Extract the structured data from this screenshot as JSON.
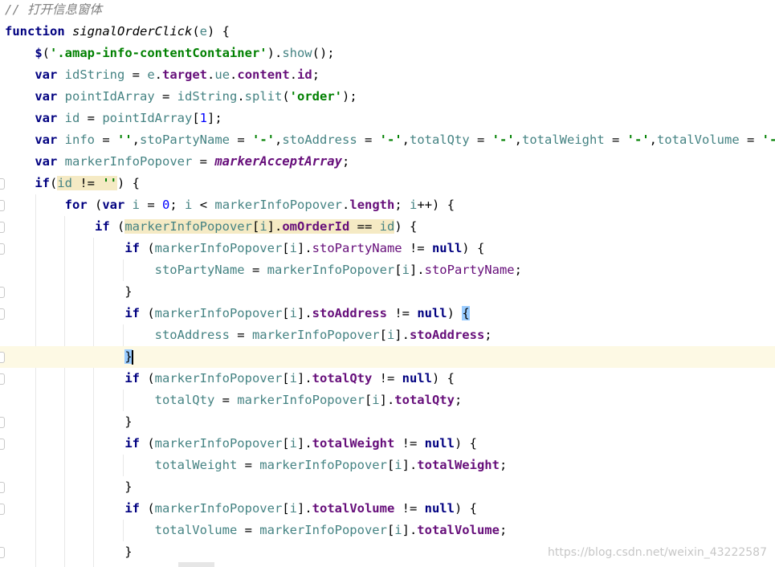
{
  "editor": {
    "comment": "// 打开信息窗体",
    "watermark": "https://blog.csdn.net/weixin_43222587"
  },
  "colors": {
    "keyword": "#000080",
    "string": "#008000",
    "local_variable": "#458383",
    "property": "#660e7a",
    "number": "#0000ff",
    "comment": "#808080",
    "caret_line": "#fdf9e4",
    "usage_highlight": "#f5eac4",
    "brace_match": "#99ccff"
  },
  "lines": [
    {
      "name": "line-1",
      "tokens": [
        [
          "cmt",
          "// 打开信息窗体"
        ]
      ]
    },
    {
      "name": "line-2",
      "tokens": [
        [
          "kw",
          "function"
        ],
        [
          "plain",
          " "
        ],
        [
          "fn",
          "signalOrderClick"
        ],
        [
          "plain",
          "("
        ],
        [
          "var",
          "e"
        ],
        [
          "plain",
          ") {"
        ]
      ]
    },
    {
      "name": "line-3",
      "tokens": [
        [
          "plain",
          "    "
        ],
        [
          "kw",
          "$"
        ],
        [
          "plain",
          "("
        ],
        [
          "str",
          "'.amap-info-contentContainer'"
        ],
        [
          "plain",
          ")."
        ],
        [
          "var",
          "show"
        ],
        [
          "plain",
          "();"
        ]
      ]
    },
    {
      "name": "line-4",
      "tokens": [
        [
          "plain",
          "    "
        ],
        [
          "kw",
          "var"
        ],
        [
          "plain",
          " "
        ],
        [
          "var",
          "idString"
        ],
        [
          "plain",
          " = "
        ],
        [
          "var",
          "e"
        ],
        [
          "plain",
          "."
        ],
        [
          "prop",
          "target"
        ],
        [
          "plain",
          "."
        ],
        [
          "var",
          "ue"
        ],
        [
          "plain",
          "."
        ],
        [
          "prop",
          "content"
        ],
        [
          "plain",
          "."
        ],
        [
          "prop",
          "id"
        ],
        [
          "plain",
          ";"
        ]
      ]
    },
    {
      "name": "line-5",
      "tokens": [
        [
          "plain",
          "    "
        ],
        [
          "kw",
          "var"
        ],
        [
          "plain",
          " "
        ],
        [
          "var",
          "pointIdArray"
        ],
        [
          "plain",
          " = "
        ],
        [
          "var",
          "idString"
        ],
        [
          "plain",
          "."
        ],
        [
          "var",
          "split"
        ],
        [
          "plain",
          "("
        ],
        [
          "str",
          "'order'"
        ],
        [
          "plain",
          ");"
        ]
      ]
    },
    {
      "name": "line-6",
      "tokens": [
        [
          "plain",
          "    "
        ],
        [
          "kw",
          "var"
        ],
        [
          "plain",
          " "
        ],
        [
          "var",
          "id"
        ],
        [
          "plain",
          " = "
        ],
        [
          "var",
          "pointIdArray"
        ],
        [
          "plain",
          "["
        ],
        [
          "num",
          "1"
        ],
        [
          "plain",
          "];"
        ]
      ]
    },
    {
      "name": "line-7",
      "tokens": [
        [
          "plain",
          "    "
        ],
        [
          "kw",
          "var"
        ],
        [
          "plain",
          " "
        ],
        [
          "var",
          "info"
        ],
        [
          "plain",
          " = "
        ],
        [
          "str",
          "''"
        ],
        [
          "plain",
          ","
        ],
        [
          "var",
          "stoPartyName"
        ],
        [
          "plain",
          " = "
        ],
        [
          "str",
          "'-'"
        ],
        [
          "plain",
          ","
        ],
        [
          "var",
          "stoAddress"
        ],
        [
          "plain",
          " = "
        ],
        [
          "str",
          "'-'"
        ],
        [
          "plain",
          ","
        ],
        [
          "var",
          "totalQty"
        ],
        [
          "plain",
          " = "
        ],
        [
          "str",
          "'-'"
        ],
        [
          "plain",
          ","
        ],
        [
          "var",
          "totalWeight"
        ],
        [
          "plain",
          " = "
        ],
        [
          "str",
          "'-'"
        ],
        [
          "plain",
          ","
        ],
        [
          "var",
          "totalVolume"
        ],
        [
          "plain",
          " = "
        ],
        [
          "str",
          "'-'"
        ],
        [
          "plain",
          ";"
        ]
      ]
    },
    {
      "name": "line-8",
      "tokens": [
        [
          "plain",
          "    "
        ],
        [
          "kw",
          "var"
        ],
        [
          "plain",
          " "
        ],
        [
          "var",
          "markerInfoPopover"
        ],
        [
          "plain",
          " = "
        ],
        [
          "glob",
          "markerAcceptArray"
        ],
        [
          "plain",
          ";"
        ]
      ]
    },
    {
      "name": "line-9",
      "tokens": [
        [
          "plain",
          "    "
        ],
        [
          "kw",
          "if"
        ],
        [
          "plain",
          "("
        ],
        [
          "hlvar",
          "id"
        ],
        [
          "hlplain",
          " != "
        ],
        [
          "hlstr",
          "''"
        ],
        [
          "plain",
          ") {"
        ]
      ]
    },
    {
      "name": "line-10",
      "tokens": [
        [
          "plain",
          "        "
        ],
        [
          "kw",
          "for"
        ],
        [
          "plain",
          " ("
        ],
        [
          "kw",
          "var"
        ],
        [
          "plain",
          " "
        ],
        [
          "var",
          "i"
        ],
        [
          "plain",
          " = "
        ],
        [
          "num",
          "0"
        ],
        [
          "plain",
          "; "
        ],
        [
          "var",
          "i"
        ],
        [
          "plain",
          " < "
        ],
        [
          "var",
          "markerInfoPopover"
        ],
        [
          "plain",
          "."
        ],
        [
          "prop",
          "length"
        ],
        [
          "plain",
          "; "
        ],
        [
          "var",
          "i"
        ],
        [
          "plain",
          "++) {"
        ]
      ]
    },
    {
      "name": "line-11",
      "tokens": [
        [
          "plain",
          "            "
        ],
        [
          "kw",
          "if"
        ],
        [
          "plain",
          " ("
        ],
        [
          "hlvar",
          "markerInfoPopover"
        ],
        [
          "hlplain",
          "["
        ],
        [
          "hlvar",
          "i"
        ],
        [
          "hlplain",
          "]."
        ],
        [
          "hlprop",
          "omOrderId"
        ],
        [
          "hlplain",
          " == "
        ],
        [
          "hlvar",
          "id"
        ],
        [
          "plain",
          ") {"
        ]
      ]
    },
    {
      "name": "line-12",
      "tokens": [
        [
          "plain",
          "                "
        ],
        [
          "kw",
          "if"
        ],
        [
          "plain",
          " ("
        ],
        [
          "var",
          "markerInfoPopover"
        ],
        [
          "plain",
          "["
        ],
        [
          "var",
          "i"
        ],
        [
          "plain",
          "]."
        ],
        [
          "propn",
          "stoPartyName"
        ],
        [
          "plain",
          " != "
        ],
        [
          "kw",
          "null"
        ],
        [
          "plain",
          ") {"
        ]
      ]
    },
    {
      "name": "line-13",
      "tokens": [
        [
          "plain",
          "                    "
        ],
        [
          "var",
          "stoPartyName"
        ],
        [
          "plain",
          " = "
        ],
        [
          "var",
          "markerInfoPopover"
        ],
        [
          "plain",
          "["
        ],
        [
          "var",
          "i"
        ],
        [
          "plain",
          "]."
        ],
        [
          "propn",
          "stoPartyName"
        ],
        [
          "plain",
          ";"
        ]
      ]
    },
    {
      "name": "line-14",
      "tokens": [
        [
          "plain",
          "                }"
        ]
      ]
    },
    {
      "name": "line-15",
      "tokens": [
        [
          "plain",
          "                "
        ],
        [
          "kw",
          "if"
        ],
        [
          "plain",
          " ("
        ],
        [
          "var",
          "markerInfoPopover"
        ],
        [
          "plain",
          "["
        ],
        [
          "var",
          "i"
        ],
        [
          "plain",
          "]."
        ],
        [
          "prop",
          "stoAddress"
        ],
        [
          "plain",
          " != "
        ],
        [
          "kw",
          "null"
        ],
        [
          "plain",
          ") "
        ],
        [
          "brace",
          "{"
        ]
      ]
    },
    {
      "name": "line-16",
      "tokens": [
        [
          "plain",
          "                    "
        ],
        [
          "var",
          "stoAddress"
        ],
        [
          "plain",
          " = "
        ],
        [
          "var",
          "markerInfoPopover"
        ],
        [
          "plain",
          "["
        ],
        [
          "var",
          "i"
        ],
        [
          "plain",
          "]."
        ],
        [
          "prop",
          "stoAddress"
        ],
        [
          "plain",
          ";"
        ]
      ]
    },
    {
      "name": "line-17",
      "tokens": [
        [
          "plain",
          "                "
        ],
        [
          "brace",
          "}"
        ]
      ]
    },
    {
      "name": "line-18",
      "tokens": [
        [
          "plain",
          "                "
        ],
        [
          "kw",
          "if"
        ],
        [
          "plain",
          " ("
        ],
        [
          "var",
          "markerInfoPopover"
        ],
        [
          "plain",
          "["
        ],
        [
          "var",
          "i"
        ],
        [
          "plain",
          "]."
        ],
        [
          "prop",
          "totalQty"
        ],
        [
          "plain",
          " != "
        ],
        [
          "kw",
          "null"
        ],
        [
          "plain",
          ") {"
        ]
      ]
    },
    {
      "name": "line-19",
      "tokens": [
        [
          "plain",
          "                    "
        ],
        [
          "var",
          "totalQty"
        ],
        [
          "plain",
          " = "
        ],
        [
          "var",
          "markerInfoPopover"
        ],
        [
          "plain",
          "["
        ],
        [
          "var",
          "i"
        ],
        [
          "plain",
          "]."
        ],
        [
          "prop",
          "totalQty"
        ],
        [
          "plain",
          ";"
        ]
      ]
    },
    {
      "name": "line-20",
      "tokens": [
        [
          "plain",
          "                }"
        ]
      ]
    },
    {
      "name": "line-21",
      "tokens": [
        [
          "plain",
          "                "
        ],
        [
          "kw",
          "if"
        ],
        [
          "plain",
          " ("
        ],
        [
          "var",
          "markerInfoPopover"
        ],
        [
          "plain",
          "["
        ],
        [
          "var",
          "i"
        ],
        [
          "plain",
          "]."
        ],
        [
          "prop",
          "totalWeight"
        ],
        [
          "plain",
          " != "
        ],
        [
          "kw",
          "null"
        ],
        [
          "plain",
          ") {"
        ]
      ]
    },
    {
      "name": "line-22",
      "tokens": [
        [
          "plain",
          "                    "
        ],
        [
          "var",
          "totalWeight"
        ],
        [
          "plain",
          " = "
        ],
        [
          "var",
          "markerInfoPopover"
        ],
        [
          "plain",
          "["
        ],
        [
          "var",
          "i"
        ],
        [
          "plain",
          "]."
        ],
        [
          "prop",
          "totalWeight"
        ],
        [
          "plain",
          ";"
        ]
      ]
    },
    {
      "name": "line-23",
      "tokens": [
        [
          "plain",
          "                }"
        ]
      ]
    },
    {
      "name": "line-24",
      "tokens": [
        [
          "plain",
          "                "
        ],
        [
          "kw",
          "if"
        ],
        [
          "plain",
          " ("
        ],
        [
          "var",
          "markerInfoPopover"
        ],
        [
          "plain",
          "["
        ],
        [
          "var",
          "i"
        ],
        [
          "plain",
          "]."
        ],
        [
          "prop",
          "totalVolume"
        ],
        [
          "plain",
          " != "
        ],
        [
          "kw",
          "null"
        ],
        [
          "plain",
          ") {"
        ]
      ]
    },
    {
      "name": "line-25",
      "tokens": [
        [
          "plain",
          "                    "
        ],
        [
          "var",
          "totalVolume"
        ],
        [
          "plain",
          " = "
        ],
        [
          "var",
          "markerInfoPopover"
        ],
        [
          "plain",
          "["
        ],
        [
          "var",
          "i"
        ],
        [
          "plain",
          "]."
        ],
        [
          "prop",
          "totalVolume"
        ],
        [
          "plain",
          ";"
        ]
      ]
    },
    {
      "name": "line-26",
      "tokens": [
        [
          "plain",
          "                }"
        ]
      ]
    }
  ]
}
